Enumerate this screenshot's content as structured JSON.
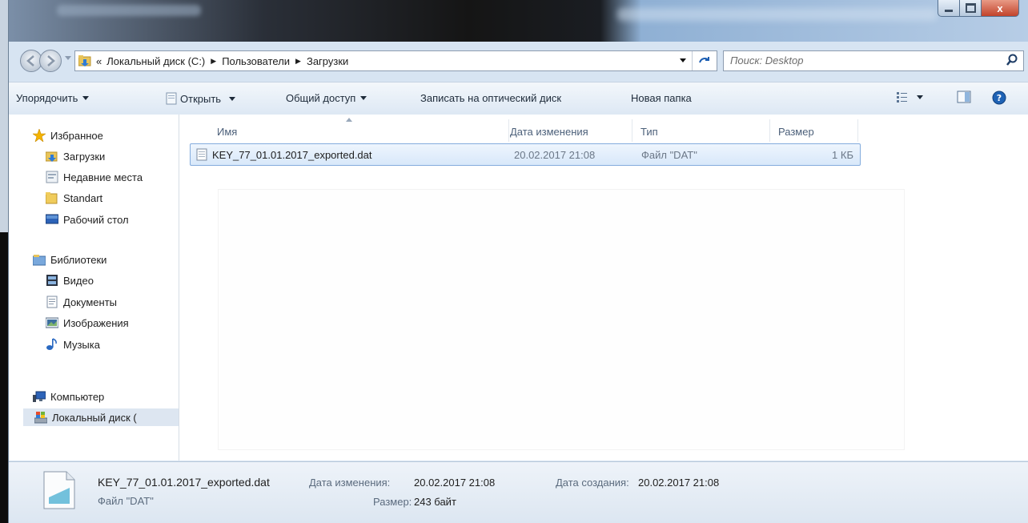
{
  "window": {
    "close_glyph": "x"
  },
  "address": {
    "overflow": "«",
    "crumbs": [
      "Локальный диск (C:)",
      "Пользователи",
      "Загрузки"
    ],
    "separator": "▶"
  },
  "search": {
    "placeholder": "Поиск: Desktop"
  },
  "toolbar": {
    "organize": "Упорядочить",
    "open": "Открыть",
    "share": "Общий доступ",
    "burn": "Записать на оптический диск",
    "new_folder": "Новая папка"
  },
  "sidebar": {
    "favorites": "Избранное",
    "favorites_items": [
      "Загрузки",
      "Недавние места",
      "Standart",
      "Рабочий стол"
    ],
    "libraries": "Библиотеки",
    "libraries_items": [
      "Видео",
      "Документы",
      "Изображения",
      "Музыка"
    ],
    "computer": "Компьютер",
    "computer_items": [
      "Локальный диск ("
    ]
  },
  "columns": {
    "name": "Имя",
    "date": "Дата изменения",
    "type": "Тип",
    "size": "Размер"
  },
  "files": [
    {
      "name": "KEY_77_01.01.2017_exported.dat",
      "date": "20.02.2017 21:08",
      "type": "Файл \"DAT\"",
      "size": "1 КБ"
    }
  ],
  "details": {
    "name": "KEY_77_01.01.2017_exported.dat",
    "type": "Файл \"DAT\"",
    "modified_label": "Дата изменения:",
    "modified_value": "20.02.2017 21:08",
    "size_label": "Размер:",
    "size_value": "243 байт",
    "created_label": "Дата создания:",
    "created_value": "20.02.2017 21:08"
  },
  "colors": {
    "accent": "#1d5fb3",
    "selection": "#d8e8fa",
    "close_red": "#c2432b"
  }
}
